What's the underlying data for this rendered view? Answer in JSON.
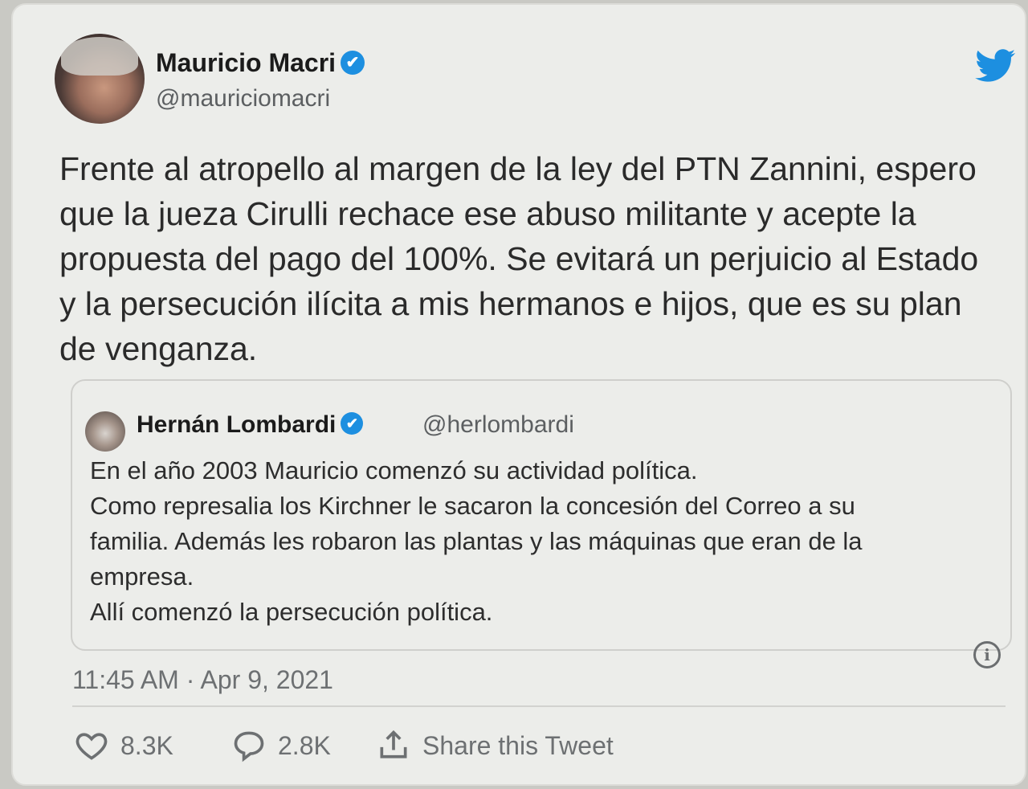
{
  "tweet": {
    "author": {
      "name": "Mauricio Macri",
      "handle": "@mauriciomacri",
      "verified": true
    },
    "text": "Frente al atropello al margen de la ley del PTN Zannini, espero que la jueza Cirulli rechace ese abuso militante y acepte la propuesta del pago del 100%. Se evitará un perjuicio al Estado y la persecución ilícita a mis hermanos e hijos, que es su plan de venganza.",
    "quoted": {
      "name": "Hernán Lombardi",
      "handle": "@herlombardi",
      "verified": true,
      "lines": [
        "En el año 2003 Mauricio comenzó su actividad política.",
        "Como represalia los Kirchner le sacaron la concesión del Correo a su",
        "familia. Además les robaron las plantas y las máquinas que eran de la",
        "empresa.",
        "Allí comenzó la persecución política."
      ]
    },
    "timestamp": "11:45 AM · Apr 9, 2021",
    "likes": "8.3K",
    "replies": "2.8K",
    "share_label": "Share this Tweet"
  },
  "icons": {
    "brand": "twitter-bird-icon",
    "verified": "verified-badge-icon",
    "info": "info-icon",
    "like": "heart-icon",
    "reply": "reply-bubble-icon",
    "share": "share-icon"
  },
  "colors": {
    "twitter_blue": "#1d8fe0",
    "verified_blue": "#1d8fe0",
    "text": "#2a2a2a",
    "secondary_text": "#6d7072"
  }
}
